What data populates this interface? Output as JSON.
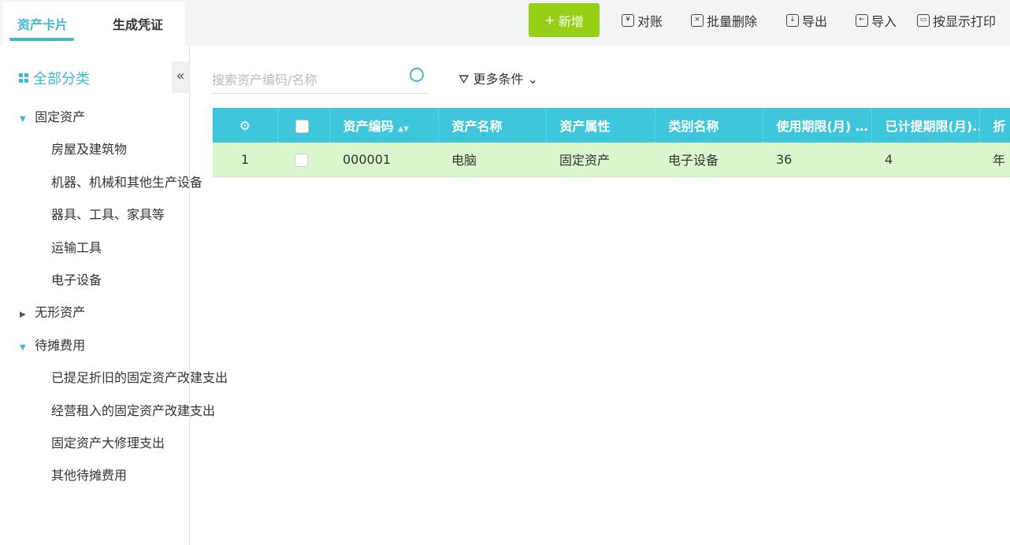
{
  "tabs": [
    "资产卡片",
    "生成凭证"
  ],
  "toolbar": {
    "add": "新增",
    "reconcile": "对账",
    "batch_delete": "批量删除",
    "export": "导出",
    "import": "导入",
    "print": "按显示打印"
  },
  "sidebar": {
    "all": "全部分类",
    "tree": [
      {
        "label": "固定资产",
        "level": 0,
        "state": "open"
      },
      {
        "label": "房屋及建筑物",
        "level": 1
      },
      {
        "label": "机器、机械和其他生产设备",
        "level": 1
      },
      {
        "label": "器具、工具、家具等",
        "level": 1
      },
      {
        "label": "运输工具",
        "level": 1
      },
      {
        "label": "电子设备",
        "level": 1
      },
      {
        "label": "无形资产",
        "level": 0,
        "state": "closed"
      },
      {
        "label": "待摊费用",
        "level": 0,
        "state": "open"
      },
      {
        "label": "已提足折旧的固定资产改建支出",
        "level": 1
      },
      {
        "label": "经营租入的固定资产改建支出",
        "level": 1
      },
      {
        "label": "固定资产大修理支出",
        "level": 1
      },
      {
        "label": "其他待摊费用",
        "level": 1
      }
    ]
  },
  "search": {
    "placeholder": "搜索资产编码/名称"
  },
  "more_filters": "更多条件",
  "table": {
    "headers": [
      "资产编码",
      "资产名称",
      "资产属性",
      "类别名称",
      "使用期限(月) …",
      "已计提期限(月)..",
      "折"
    ],
    "rows": [
      {
        "index": "1",
        "code": "000001",
        "name": "电脑",
        "attr": "固定资产",
        "category": "电子设备",
        "life": "36",
        "used": "4",
        "dep": "年"
      }
    ]
  }
}
